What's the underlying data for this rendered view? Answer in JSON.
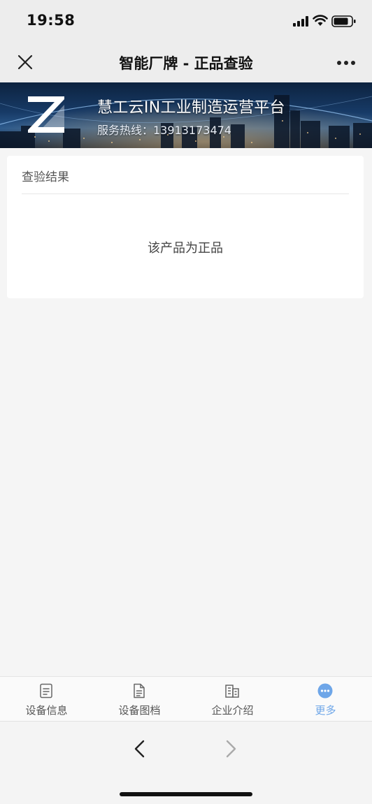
{
  "status_bar": {
    "time": "19:58",
    "icons": [
      "signal-icon",
      "wifi-icon",
      "battery-icon"
    ]
  },
  "nav": {
    "title": "智能厂牌 - 正品查验",
    "close_icon": "close-icon",
    "more_icon": "more-icon"
  },
  "banner": {
    "title": "慧工云IN工业制造运营平台",
    "hotline": "服务热线：13913173474"
  },
  "result_card": {
    "title": "查验结果",
    "result": "该产品为正品"
  },
  "tabs": [
    {
      "label": "设备信息",
      "icon": "document-icon",
      "active": false
    },
    {
      "label": "设备图档",
      "icon": "file-icon",
      "active": false
    },
    {
      "label": "企业介绍",
      "icon": "building-icon",
      "active": false
    },
    {
      "label": "更多",
      "icon": "more-dots-icon",
      "active": true
    }
  ],
  "colors": {
    "accent": "#6ea6e8",
    "nav_bg": "#ededed",
    "page_bg": "#f5f5f5"
  }
}
